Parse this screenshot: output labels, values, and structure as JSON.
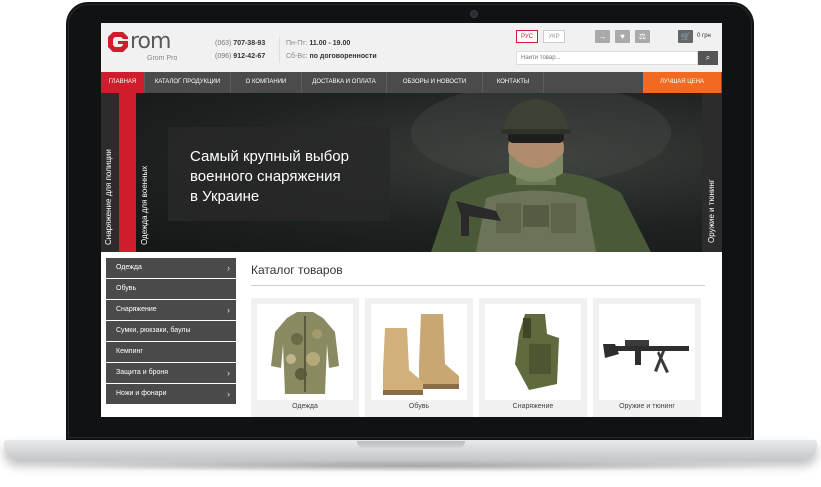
{
  "header": {
    "logo_text": "rom",
    "logo_sub": "Grom Pro",
    "phone1_code": "(063)",
    "phone1_number": "707-38-93",
    "phone2_code": "(096)",
    "phone2_number": "912-42-67",
    "hours1_label": "Пн-Пт:",
    "hours1_value": "11.00 - 19.00",
    "hours2_label": "Сб-Вс:",
    "hours2_value": "по договоренности",
    "lang_ru": "РУС",
    "lang_ua": "УКР",
    "cart_text": "0 грн",
    "search_placeholder": "Найти товар..."
  },
  "nav": [
    {
      "label": "Главная"
    },
    {
      "label": "Каталог продукции"
    },
    {
      "label": "О компании"
    },
    {
      "label": "Доставка и оплата"
    },
    {
      "label": "Обзоры и новости"
    },
    {
      "label": "Контакты"
    },
    {
      "label": "Лучшая цена"
    }
  ],
  "hero": {
    "tab_left": "Снаряжение для полиции",
    "tab_red": "Одежда для военных",
    "tab_right": "Оружие и тюнинг",
    "title": "Самый крупный выбор\nвоенного снаряжения\nв Украине"
  },
  "sidebar": [
    {
      "label": "Одежда",
      "has_arrow": true
    },
    {
      "label": "Обувь",
      "has_arrow": false
    },
    {
      "label": "Снаряжение",
      "has_arrow": true
    },
    {
      "label": "Сумки, рюкзаки, баулы",
      "has_arrow": false
    },
    {
      "label": "Кемпинг",
      "has_arrow": false
    },
    {
      "label": "Защита и броня",
      "has_arrow": true
    },
    {
      "label": "Ножи и фонари",
      "has_arrow": true
    }
  ],
  "catalog": {
    "title": "Каталог товаров",
    "items": [
      {
        "label": "Одежда",
        "icon": "camo-jacket"
      },
      {
        "label": "Обувь",
        "icon": "tactical-boots"
      },
      {
        "label": "Снаряжение",
        "icon": "holster"
      },
      {
        "label": "Оружие и тюнинг",
        "icon": "rifle"
      }
    ]
  },
  "colors": {
    "accent_red": "#cf1d2e",
    "accent_orange": "#f26a21",
    "nav_bg": "#4b4b4b"
  }
}
